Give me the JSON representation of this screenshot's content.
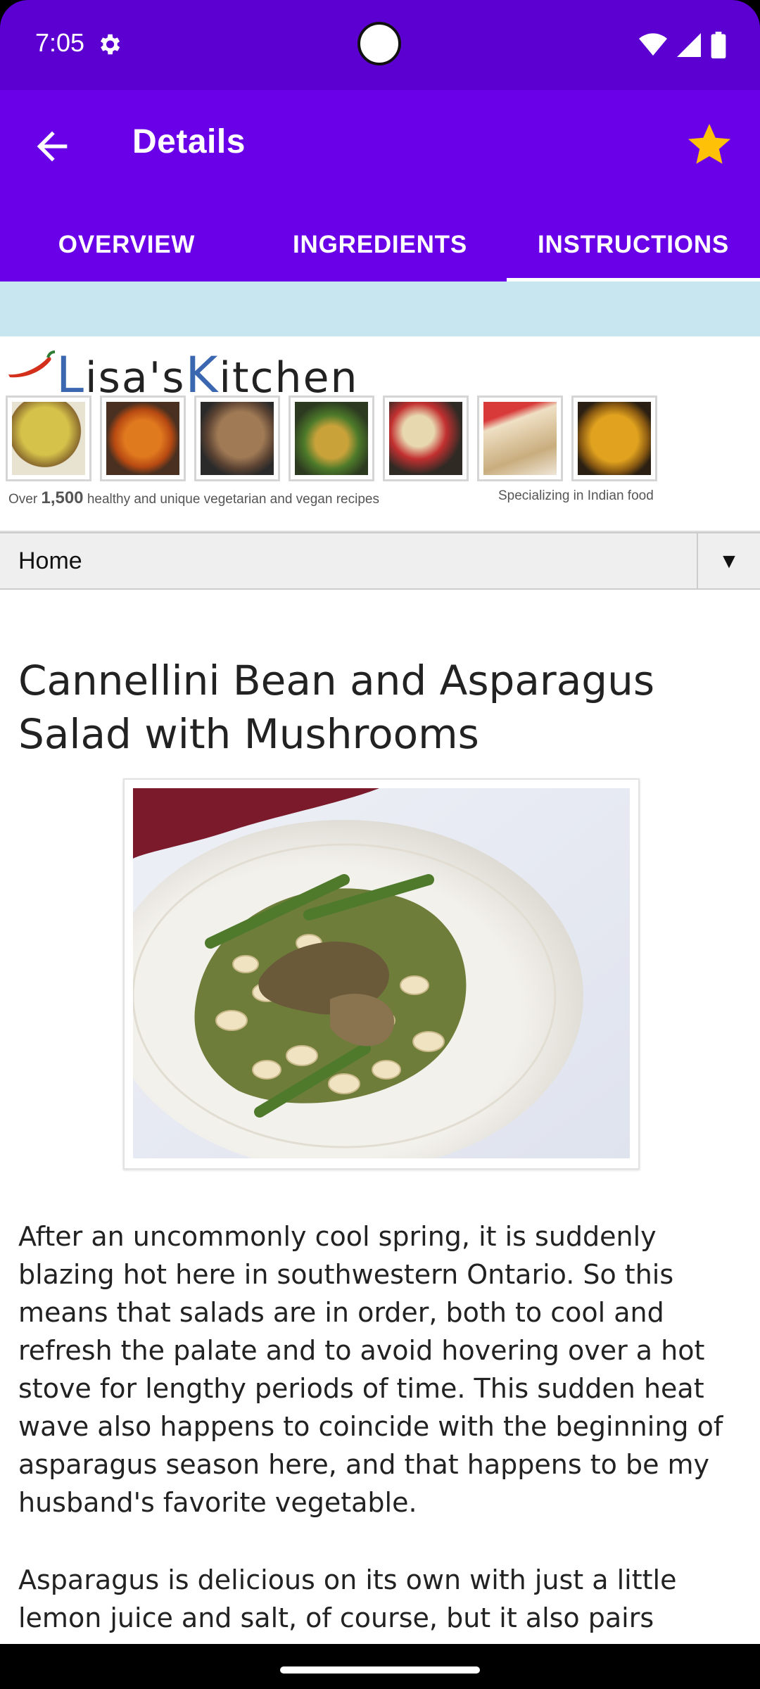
{
  "status_bar": {
    "time": "7:05"
  },
  "app_bar": {
    "title": "Details"
  },
  "tabs": [
    {
      "label": "OVERVIEW"
    },
    {
      "label": "INGREDIENTS"
    },
    {
      "label": "INSTRUCTIONS"
    }
  ],
  "banner": {
    "logo_l": "L",
    "logo_mid": "isa's",
    "logo_k": "K",
    "logo_end": "itchen",
    "note_left_prefix": "Over",
    "note_left_number": "1,500",
    "note_left_suffix": "healthy and unique vegetarian and vegan recipes",
    "note_right": "Specializing in Indian food"
  },
  "nav_select": {
    "selected": "Home",
    "arrow": "▼"
  },
  "article": {
    "title": "Cannellini Bean and Asparagus Salad with Mushrooms",
    "paragraph_1": "After an uncommonly cool spring, it is suddenly blazing hot here in southwestern Ontario. So this means that salads are in order, both to cool and refresh the palate and to avoid hovering over a hot stove for lengthy periods of time. This sudden heat wave also happens to coincide with the beginning of asparagus season here, and that happens to be my husband's favorite vegetable.",
    "paragraph_2": "Asparagus is delicious on its own with just a little lemon juice and salt, of course, but it also pairs"
  },
  "colors": {
    "status_bar": "#5c00d2",
    "app_bar": "#6a00e8",
    "star": "#ffc107",
    "blue_strip": "#c8e6f0"
  },
  "icons": [
    "gear-icon",
    "wifi-icon",
    "signal-icon",
    "battery-icon",
    "back-arrow-icon",
    "star-icon",
    "chili-icon"
  ]
}
